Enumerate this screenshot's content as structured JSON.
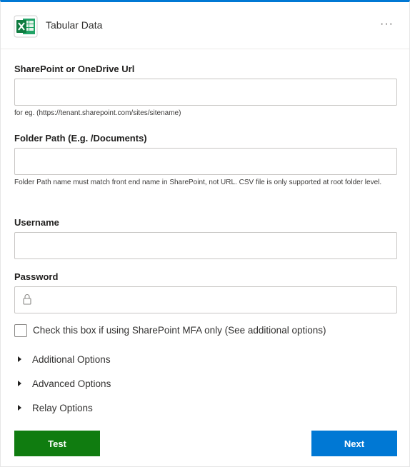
{
  "header": {
    "title": "Tabular Data",
    "more_glyph": "···",
    "icon": "excel-icon",
    "accent_color": "#0078d4"
  },
  "form": {
    "sharepoint_url": {
      "label": "SharePoint or OneDrive Url",
      "value": "",
      "help": "for eg. (https://tenant.sharepoint.com/sites/sitename)"
    },
    "folder_path": {
      "label": "Folder Path (E.g. /Documents)",
      "value": "",
      "help": "Folder Path name must match front end name in SharePoint, not URL. CSV file is only supported at root folder level."
    },
    "username": {
      "label": "Username",
      "value": ""
    },
    "password": {
      "label": "Password",
      "value": "",
      "icon": "lock-icon"
    },
    "mfa_checkbox": {
      "label": "Check this box if using SharePoint MFA only (See additional options)",
      "checked": false
    }
  },
  "sections": [
    {
      "label": "Additional Options",
      "expanded": false
    },
    {
      "label": "Advanced Options",
      "expanded": false
    },
    {
      "label": "Relay Options",
      "expanded": false
    }
  ],
  "buttons": {
    "test": {
      "label": "Test",
      "color": "#107c10"
    },
    "next": {
      "label": "Next",
      "color": "#0078d4"
    }
  }
}
